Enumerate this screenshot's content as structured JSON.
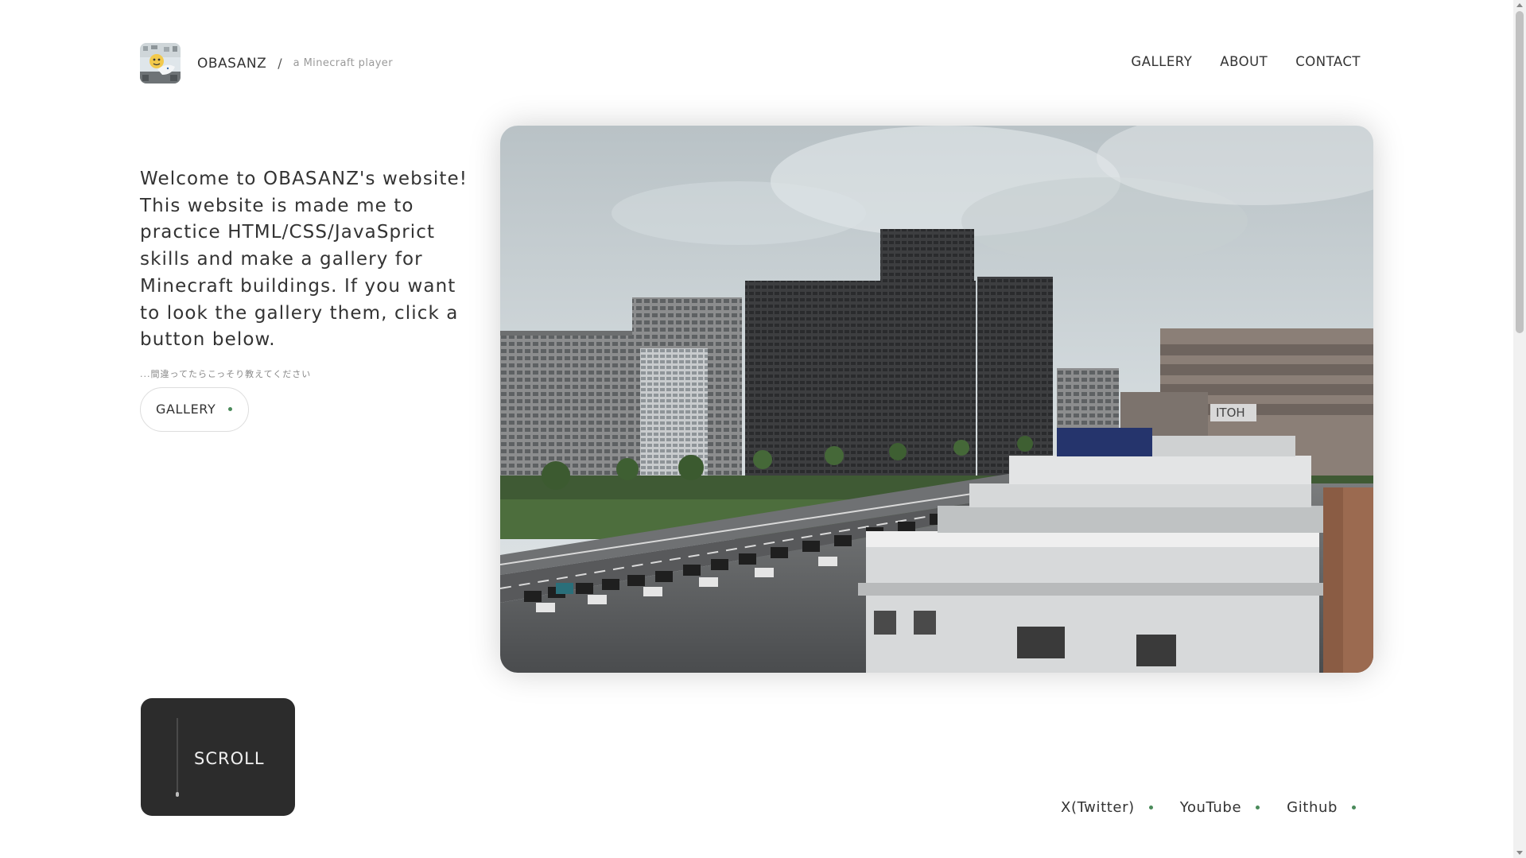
{
  "header": {
    "site_name": "OBASANZ",
    "separator": "/",
    "tagline": "a Minecraft player",
    "logo_icon": "avatar-icon"
  },
  "nav": {
    "items": [
      {
        "label": "GALLERY"
      },
      {
        "label": "ABOUT"
      },
      {
        "label": "CONTACT"
      }
    ]
  },
  "intro": {
    "text": "Welcome to OBASANZ's website! This website is made me to practice HTML/CSS/JavaSprict skills and make a gallery for Minecraft buildings. If you want to look the gallery them, click a button below.",
    "note": "...間違ってたらこっそり教えてください",
    "button_label": "GALLERY"
  },
  "hero": {
    "image_icon": "minecraft-city-image",
    "sign_text": "ITOH"
  },
  "scroll": {
    "label": "SCROLL"
  },
  "socials": [
    {
      "label": "X(Twitter)"
    },
    {
      "label": "YouTube"
    },
    {
      "label": "Github"
    }
  ],
  "colors": {
    "accent_dot": "#4a8a5a",
    "scroll_box": "#2c2c2c",
    "text": "#333333"
  }
}
